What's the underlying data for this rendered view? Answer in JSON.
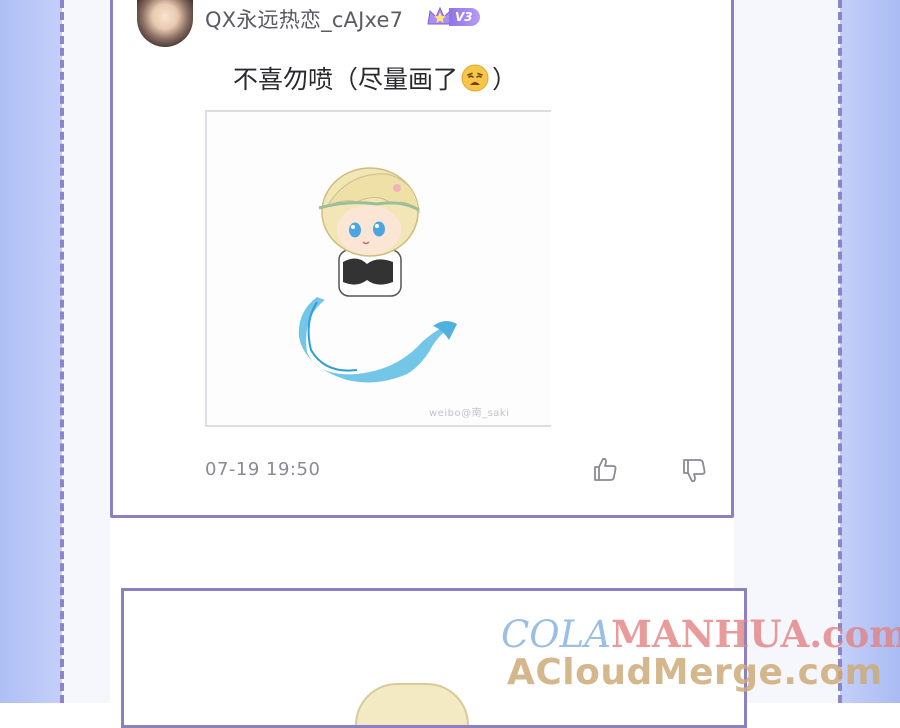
{
  "post": {
    "username": "QX永远热恋_cAJxe7",
    "vip_level": "V3",
    "comment_text": "不喜勿喷（尽量画了",
    "comment_text_end": "）",
    "emoji": "weary-face-emoji",
    "image_watermark": "weibo@南_saki",
    "timestamp": "07-19 19:50",
    "like_icon": "thumbs-up-icon",
    "dislike_icon": "thumbs-down-icon"
  },
  "watermark": {
    "line1_part1": "COLA",
    "line1_part2": "MANHUA",
    "line1_part3": ".com",
    "line2": "ACloudMerge.com"
  },
  "colors": {
    "card_border": "#8a80c2",
    "side_strip": "#b9c9f7",
    "vip_badge": "#9b80ea"
  }
}
